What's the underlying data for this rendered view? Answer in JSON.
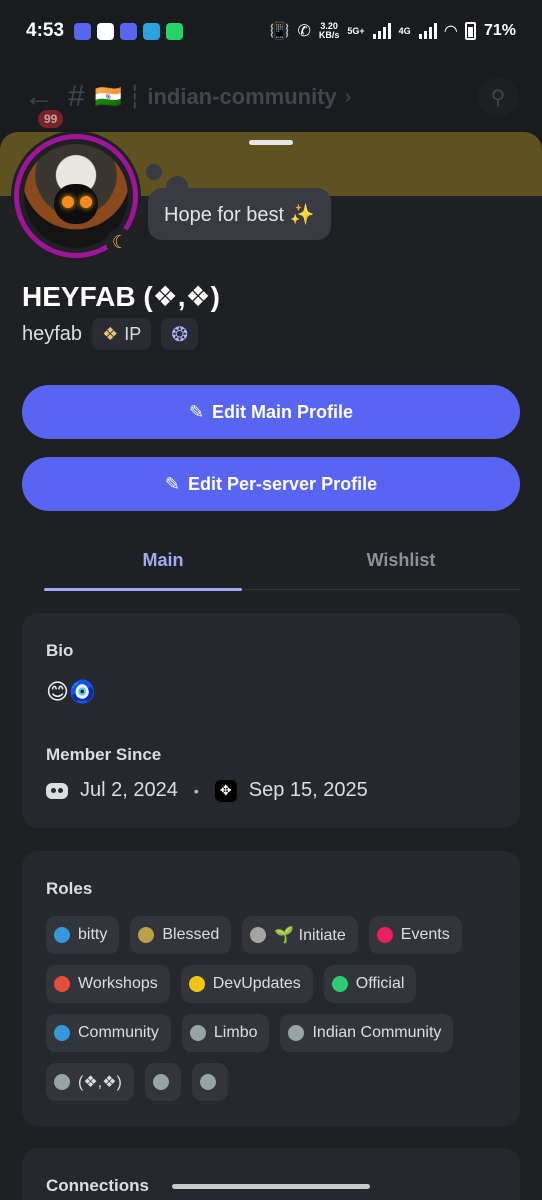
{
  "status_bar": {
    "time": "4:53",
    "speed_value": "3.20",
    "speed_unit": "KB/s",
    "network": "5G+",
    "network2": "4G",
    "battery": "71%"
  },
  "channel_header": {
    "unread_badge": "99",
    "flag": "🇮🇳",
    "name": "indian-community",
    "arrow": "›"
  },
  "profile": {
    "status_bubble": "Hope for best ✨",
    "display_name": "HEYFAB (❖,❖)",
    "username": "heyfab",
    "tag_label": "IP",
    "tag_icon": "❖",
    "laurel_icon": "❂"
  },
  "buttons": {
    "edit_main": "Edit Main Profile",
    "edit_server": "Edit Per-server Profile",
    "pencil": "✎"
  },
  "tabs": [
    "Main",
    "Wishlist"
  ],
  "bio": {
    "title": "Bio",
    "text": "😊🧿",
    "member_since_title": "Member Since",
    "discord_date": "Jul 2, 2024",
    "server_date": "Sep 15, 2025",
    "server_icon": "✥",
    "separator": "•"
  },
  "roles": {
    "title": "Roles",
    "items": [
      {
        "label": "bitty",
        "color": "#3498db"
      },
      {
        "label": "Blessed",
        "color": "#b9a049"
      },
      {
        "label": "🌱 Initiate",
        "color": "#a5a5a5"
      },
      {
        "label": "Events",
        "color": "#e91e63"
      },
      {
        "label": "Workshops",
        "color": "#e74c3c"
      },
      {
        "label": "DevUpdates",
        "color": "#f1c40f"
      },
      {
        "label": "Official",
        "color": "#2ecc71"
      },
      {
        "label": "Community",
        "color": "#3498db"
      },
      {
        "label": "Limbo",
        "color": "#95a5a6"
      },
      {
        "label": "Indian Community",
        "color": "#95a5a6"
      },
      {
        "label": "(❖,❖)",
        "color": "#95a5a6"
      },
      {
        "label": "",
        "color": "#95a5a6"
      },
      {
        "label": "",
        "color": "#95a5a6"
      }
    ]
  },
  "connections": {
    "title": "Connections"
  },
  "colors": {
    "accent": "#5865f2",
    "banner": "#5e5320",
    "avatar_ring": "#a0149a"
  }
}
